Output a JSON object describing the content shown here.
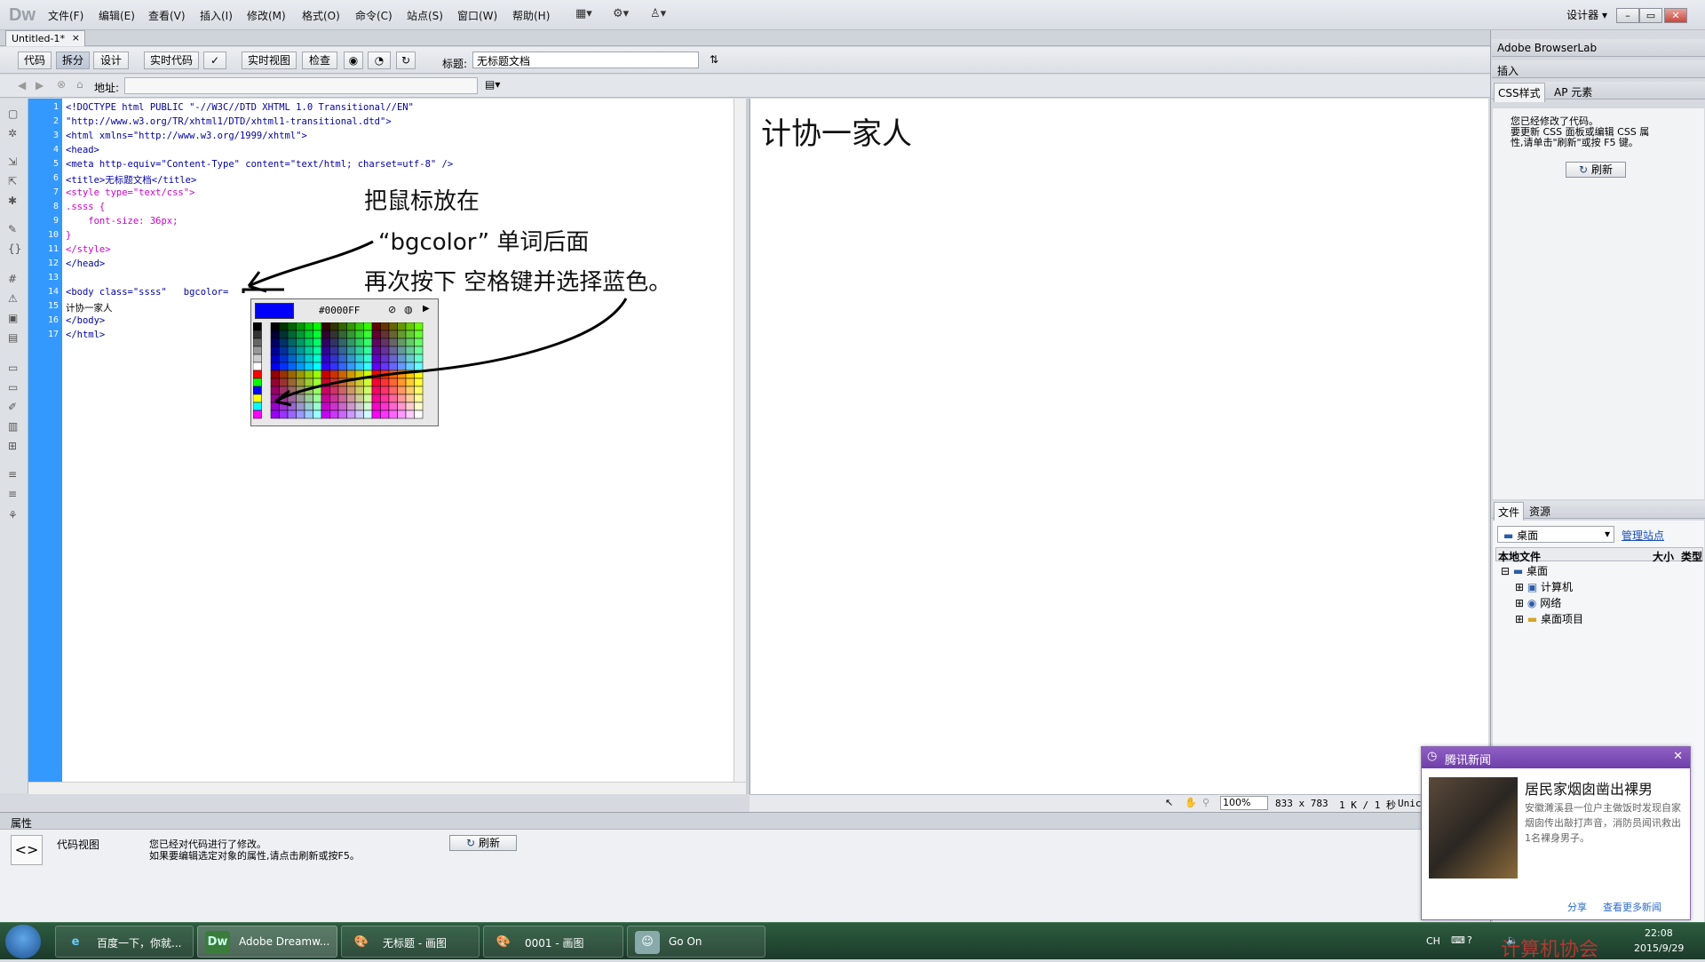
{
  "app": {
    "logo": "Dw",
    "menus": [
      "文件(F)",
      "编辑(E)",
      "查看(V)",
      "插入(I)",
      "修改(M)",
      "格式(O)",
      "命令(C)",
      "站点(S)",
      "窗口(W)",
      "帮助(H)"
    ],
    "workspace": "设计器",
    "window_buttons": [
      "–",
      "▭",
      "✕"
    ]
  },
  "doc_tab": {
    "label": "Untitled-1*",
    "close": "×"
  },
  "toolbar": {
    "buttons": [
      "代码",
      "拆分",
      "设计",
      "实时代码",
      "实时视图",
      "检查"
    ],
    "title_label": "标题:",
    "title_value": "无标题文档"
  },
  "addressbar": {
    "label": "地址:",
    "value": ""
  },
  "code": {
    "line_numbers": [
      "1",
      "",
      "2",
      "3",
      "4",
      "5",
      "6",
      "7",
      "8",
      "9",
      "10",
      "11",
      "12",
      "13",
      "14",
      "15",
      "16",
      "17"
    ],
    "lines": [
      "<!DOCTYPE html PUBLIC \"-//W3C//DTD XHTML 1.0 Transitional//EN\"",
      "\"http://www.w3.org/TR/xhtml1/DTD/xhtml1-transitional.dtd\">",
      "<html xmlns=\"http://www.w3.org/1999/xhtml\">",
      "<head>",
      "<meta http-equiv=\"Content-Type\" content=\"text/html; charset=utf-8\" />",
      "<title>无标题文档</title>",
      "<style type=\"text/css\">",
      ".ssss {",
      "    font-size: 36px;",
      "}",
      "</style>",
      "</head>",
      "",
      "<body class=\"ssss\"   bgcolor=",
      "计协一家人",
      "</body>",
      "</html>",
      ""
    ]
  },
  "color_picker": {
    "hex": "#0000FF",
    "swatch": "#0000ff"
  },
  "annotation": {
    "line1": "把鼠标放在",
    "line2": "“bgcolor”  单词后面",
    "line3": "再次按下 空格键并选择蓝色。"
  },
  "design": {
    "text": "计协一家人"
  },
  "statusbar": {
    "zoom": "100%",
    "size": "833 x 783",
    "weight": "1 K / 1 秒",
    "encoding": "Unic"
  },
  "props": {
    "header": "属性",
    "view_label": "代码视图",
    "msg1": "您已经对代码进行了修改。",
    "msg2": "如果要编辑选定对象的属性,请点击刷新或按F5。",
    "refresh": "刷新"
  },
  "right": {
    "browserlab": "Adobe BrowserLab",
    "insert": "插入",
    "css_tab": "CSS样式",
    "ap_tab": "AP 元素",
    "css_msg1": "您已经修改了代码。",
    "css_msg2": "要更新 CSS 面板或编辑 CSS 属",
    "css_msg3": "性,请单击\"刷新\"或按 F5 键。",
    "css_refresh": "刷新",
    "files_tab": "文件",
    "assets_tab": "资源",
    "site": "桌面",
    "manage": "管理站点",
    "col_local": "本地文件",
    "col_size": "大小",
    "col_type": "类型",
    "tree": [
      "桌面",
      "计算机",
      "网络",
      "桌面项目"
    ]
  },
  "news": {
    "header": "腾讯新闻",
    "title": "居民家烟囱凿出裸男",
    "desc": "安徽濉溪县一位户主做饭时发现自家烟囱传出敲打声音，消防员闻讯救出1名裸身男子。",
    "share": "分享",
    "more": "查看更多新闻"
  },
  "taskbar": {
    "tasks": [
      "百度一下，你就...",
      "Adobe Dreamw...",
      "无标题 - 画图",
      "0001 - 画图",
      "Go On"
    ],
    "lang": "CH",
    "time": "22:08",
    "date": "2015/9/29",
    "watermark": "计算机协会"
  },
  "colors": {
    "gutter": "#3399ff",
    "accent": "#0000ff",
    "news": "#7a4bb5"
  }
}
